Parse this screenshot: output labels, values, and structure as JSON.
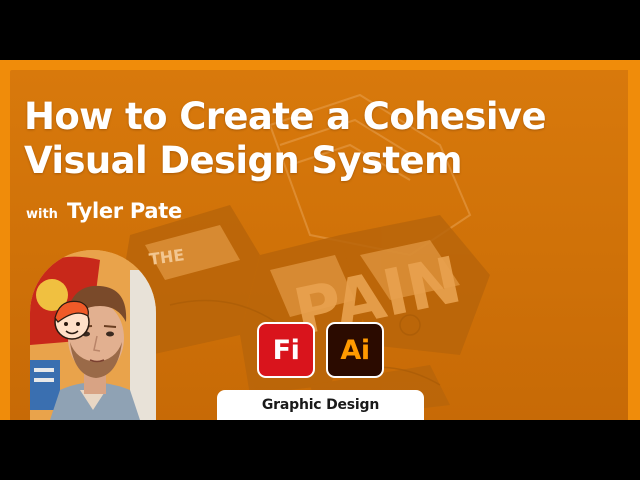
{
  "colors": {
    "letterbox": "#000000",
    "frame_orange": "#f08c0a",
    "panel_orange": "#d37509",
    "fresco_red": "#d9141c",
    "illustrator_dark": "#2b0b00",
    "illustrator_orange": "#ff9a00",
    "text_white": "#ffffff"
  },
  "title": {
    "line1": "How to Create a Cohesive",
    "line2": "Visual Design System"
  },
  "byline": {
    "prefix": "with",
    "name": "Tyler Pate"
  },
  "apps": [
    {
      "label": "Fi",
      "icon": "adobe-fresco-icon"
    },
    {
      "label": "Ai",
      "icon": "adobe-illustrator-icon"
    }
  ],
  "category": {
    "label": "Graphic Design"
  },
  "artwork": {
    "text_the": "THE",
    "text_pain": "PAIN"
  }
}
